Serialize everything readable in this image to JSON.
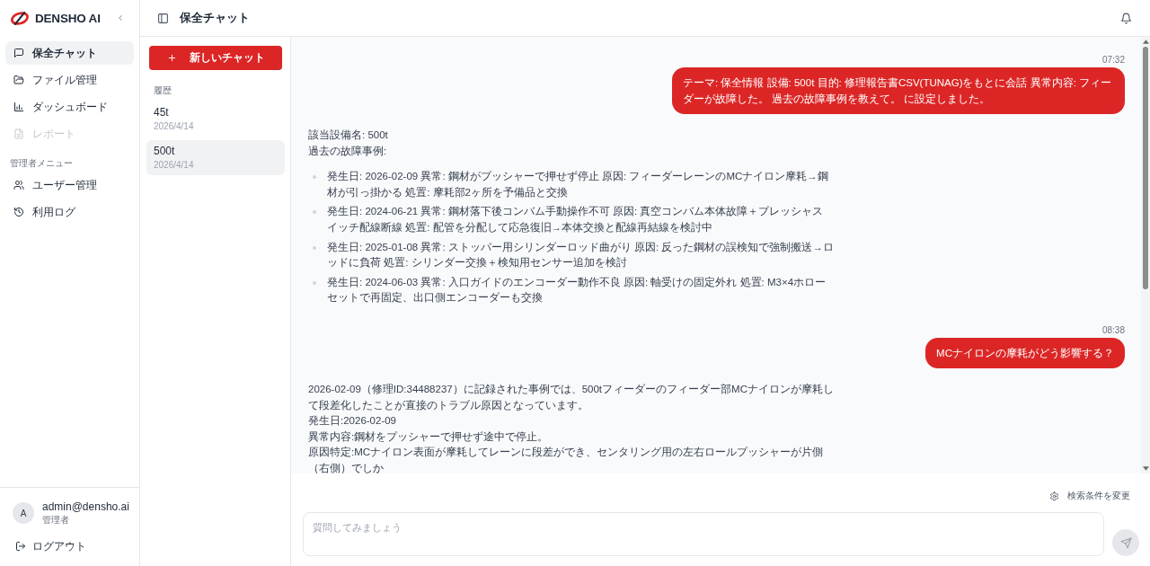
{
  "sidebar": {
    "brand": "DENSHO AI",
    "nav": [
      {
        "label": "保全チャット",
        "selected": true,
        "disabled": false
      },
      {
        "label": "ファイル管理",
        "selected": false,
        "disabled": false
      },
      {
        "label": "ダッシュボード",
        "selected": false,
        "disabled": false
      },
      {
        "label": "レポート",
        "selected": false,
        "disabled": true
      }
    ],
    "admin_menu": {
      "title": "管理者メニュー",
      "items": [
        {
          "label": "ユーザー管理",
          "selected": false
        },
        {
          "label": "利用ログ",
          "selected": false
        }
      ]
    },
    "user": {
      "avatar": "A",
      "email": "admin@densho.ai",
      "role": "管理者"
    },
    "logout": "ログアウト"
  },
  "header": {
    "title": "保全チャット"
  },
  "chat_list": {
    "new_chat_button": "新しいチャット",
    "history_label": "履歴",
    "items": [
      {
        "title": "45t",
        "date": "2026/4/14",
        "selected": false
      },
      {
        "title": "500t",
        "date": "2026/4/14",
        "selected": true
      }
    ]
  },
  "messages": [
    {
      "kind": "user",
      "time": "07:32",
      "text": "テーマ: 保全情報 設備: 500t 目的: 修理報告書CSV(TUNAG)をもとに会話 異常内容: フィーダーが故障した。 過去の故障事例を教えて。 に設定しました。"
    },
    {
      "kind": "assistant",
      "paragraphs": [
        "該当設備名: 500t",
        "過去の故障事例:"
      ],
      "bullets": [
        "発生日: 2026-02-09 異常: 鋼材がプッシャーで押せず停止 原因: フィーダーレーンのMCナイロン摩耗→鋼材が引っ掛かる 処置: 摩耗部2ヶ所を予備品と交換",
        "発生日: 2024-06-21 異常: 鋼材落下後コンバム手動操作不可 原因: 真空コンバム本体故障＋プレッシャスイッチ配線断線 処置: 配管を分配して応急復旧→本体交換と配線再結線を検討中",
        "発生日: 2025-01-08 異常: ストッパー用シリンダーロッド曲がり 原因: 反った鋼材の誤検知で強制搬送→ロッドに負荷 処置: シリンダー交換＋検知用センサー追加を検討",
        "発生日: 2024-06-03 異常: 入口ガイドのエンコーダー動作不良 原因: 軸受けの固定外れ 処置: M3×4ホローセットで再固定、出口側エンコーダーも交換"
      ]
    },
    {
      "kind": "user",
      "time": "08:38",
      "text": "MCナイロンの摩耗がどう影響する？"
    },
    {
      "kind": "assistant",
      "paragraphs": [
        "2026-02-09（修理ID:34488237）に記録された事例では、500tフィーダーのフィーダー部MCナイロンが摩耗して段差化したことが直接のトラブル原因となっています。",
        "発生日:2026-02-09",
        "異常内容:鋼材をプッシャーで押せず途中で停止。",
        "原因特定:MCナイロン表面が摩耗してレーンに段差ができ、センタリング用の左右ロールプッシャーが片側（右側）でしか"
      ]
    }
  ],
  "composer": {
    "settings_link": "検索条件を変更",
    "placeholder": "質問してみましょう"
  }
}
